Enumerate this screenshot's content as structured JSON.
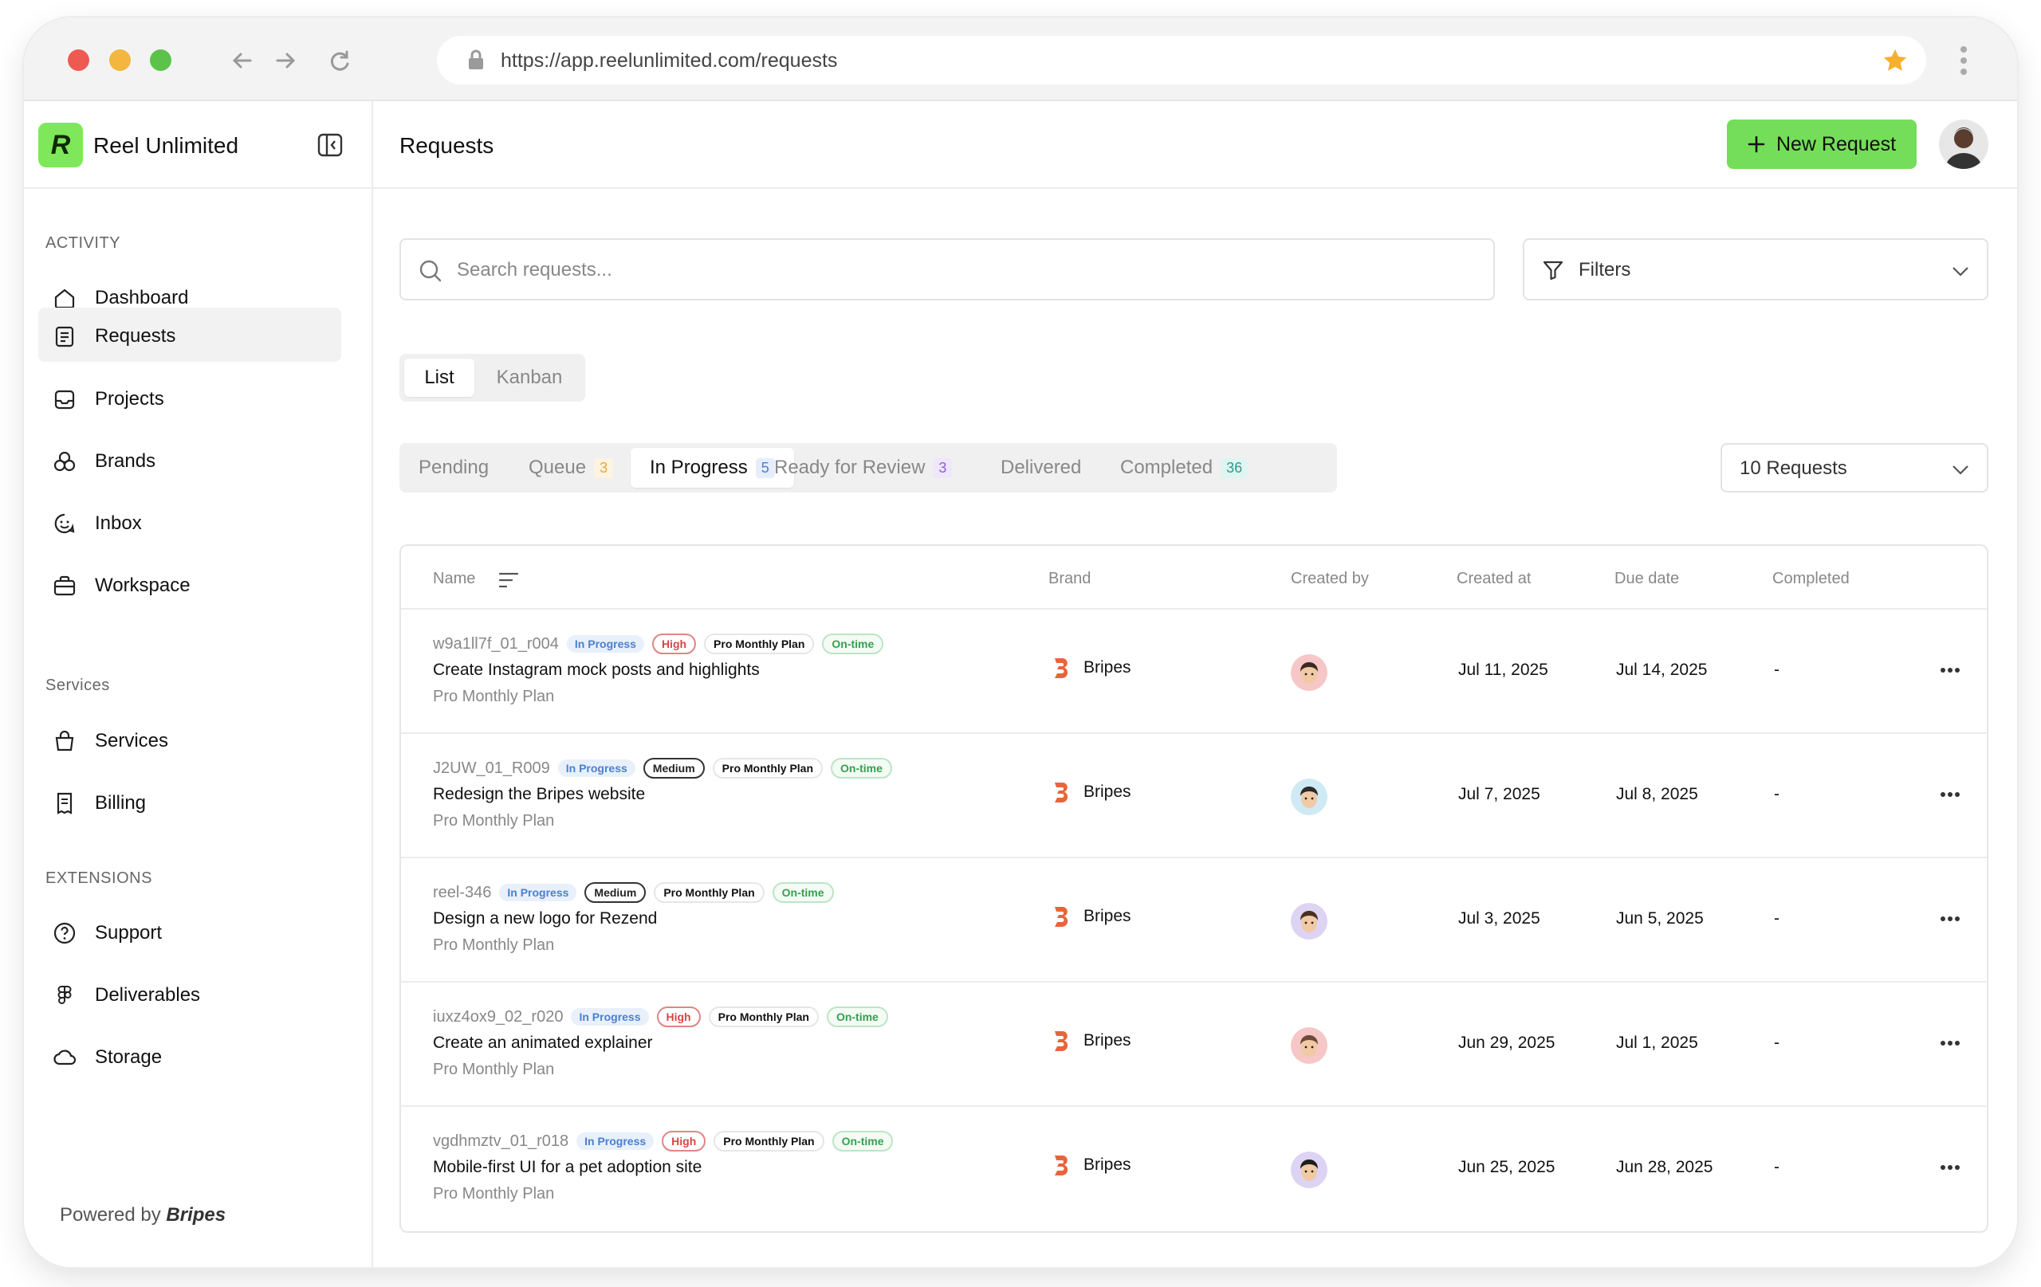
{
  "browser": {
    "url": "https://app.reelunlimited.com/requests"
  },
  "sidebar": {
    "app_name": "Reel Unlimited",
    "logo_letter": "R",
    "sections": [
      {
        "title": "ACTIVITY",
        "items": [
          {
            "label": "Dashboard",
            "icon": "home-icon"
          },
          {
            "label": "Requests",
            "icon": "clipboard-icon",
            "active": true
          },
          {
            "label": "Projects",
            "icon": "inbox-tray-icon"
          },
          {
            "label": "Brands",
            "icon": "shapes-icon"
          },
          {
            "label": "Inbox",
            "icon": "smile-chat-icon"
          },
          {
            "label": "Workspace",
            "icon": "briefcase-icon"
          }
        ]
      },
      {
        "title": "Services",
        "items": [
          {
            "label": "Services",
            "icon": "shopping-bag-icon"
          },
          {
            "label": "Billing",
            "icon": "receipt-icon"
          }
        ]
      },
      {
        "title": "EXTENSIONS",
        "items": [
          {
            "label": "Support",
            "icon": "help-circle-icon"
          },
          {
            "label": "Deliverables",
            "icon": "figma-icon"
          },
          {
            "label": "Storage",
            "icon": "cloud-icon"
          }
        ]
      }
    ],
    "powered_by": "Powered by",
    "powered_brand": "Bripes"
  },
  "header": {
    "title": "Requests",
    "new_button": "New Request"
  },
  "search": {
    "placeholder": "Search requests..."
  },
  "filters": {
    "label": "Filters"
  },
  "view_toggle": [
    "List",
    "Kanban"
  ],
  "status_tabs": [
    {
      "label": "Pending",
      "count": ""
    },
    {
      "label": "Queue",
      "count": "3",
      "color": "#e8a93a",
      "bg": "#fcf3e0"
    },
    {
      "label": "In Progress",
      "count": "5",
      "color": "#4b7fd0",
      "bg": "#e6eefb",
      "active": true
    },
    {
      "label": "Ready for Review",
      "count": "3",
      "color": "#8f5fd0",
      "bg": "#efe6fb"
    },
    {
      "label": "Delivered",
      "count": ""
    },
    {
      "label": "Completed",
      "count": "36",
      "color": "#2f9a8a",
      "bg": "#dff5f1"
    }
  ],
  "request_count": "10 Requests",
  "table": {
    "headers": [
      "Name",
      "Brand",
      "Created by",
      "Created at",
      "Due date",
      "Completed"
    ],
    "rows": [
      {
        "id": "w9a1ll7f_01_r004",
        "status": "In Progress",
        "priority": "High",
        "plan_badge": "Pro Monthly Plan",
        "timeliness": "On-time",
        "title": "Create Instagram mock posts and highlights",
        "plan": "Pro Monthly Plan",
        "brand": "Bripes",
        "created_at": "Jul 11, 2025",
        "due": "Jul 14, 2025",
        "completed": "-",
        "avatar_bg": "#f6c7c7",
        "avatar_hair": "#3b2a22"
      },
      {
        "id": "J2UW_01_R009",
        "status": "In Progress",
        "priority": "Medium",
        "plan_badge": "Pro Monthly Plan",
        "timeliness": "On-time",
        "title": "Redesign the Bripes website",
        "plan": "Pro Monthly Plan",
        "brand": "Bripes",
        "created_at": "Jul 7, 2025",
        "due": "Jul 8, 2025",
        "completed": "-",
        "avatar_bg": "#cfeaf5",
        "avatar_hair": "#2b2b2b"
      },
      {
        "id": "reel-346",
        "status": "In Progress",
        "priority": "Medium",
        "plan_badge": "Pro Monthly Plan",
        "timeliness": "On-time",
        "title": "Design a new logo for Rezend",
        "plan": "Pro Monthly Plan",
        "brand": "Bripes",
        "created_at": "Jul 3, 2025",
        "due": "Jun 5, 2025",
        "completed": "-",
        "avatar_bg": "#ddd3f3",
        "avatar_hair": "#4a3020"
      },
      {
        "id": "iuxz4ox9_02_r020",
        "status": "In Progress",
        "priority": "High",
        "plan_badge": "Pro Monthly Plan",
        "timeliness": "On-time",
        "title": "Create an animated explainer",
        "plan": "Pro Monthly Plan",
        "brand": "Bripes",
        "created_at": "Jun 29, 2025",
        "due": "Jul 1, 2025",
        "completed": "-",
        "avatar_bg": "#f6c7c7",
        "avatar_hair": "#6b4a3a"
      },
      {
        "id": "vgdhmztv_01_r018",
        "status": "In Progress",
        "priority": "High",
        "plan_badge": "Pro Monthly Plan",
        "timeliness": "On-time",
        "title": "Mobile-first UI for a pet adoption site",
        "plan": "Pro Monthly Plan",
        "brand": "Bripes",
        "created_at": "Jun 25, 2025",
        "due": "Jun 28, 2025",
        "completed": "-",
        "avatar_bg": "#ddd3f3",
        "avatar_hair": "#1e1e1e"
      }
    ]
  },
  "colors": {
    "accent": "#74dd59",
    "brand_logo": "#e8643a"
  }
}
